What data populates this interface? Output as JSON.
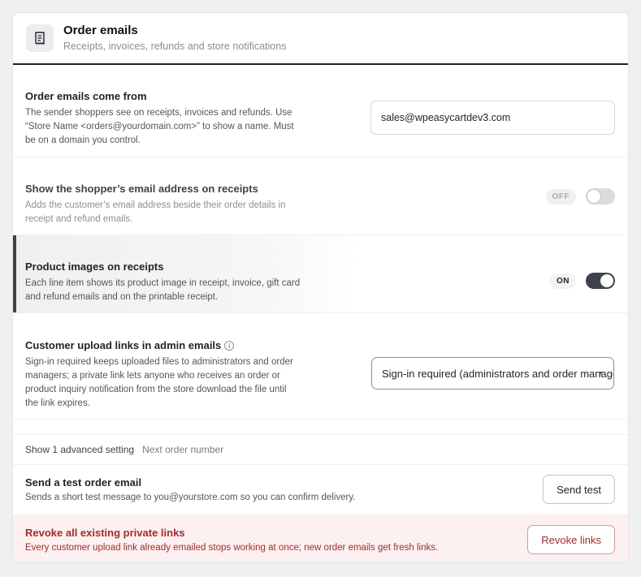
{
  "header": {
    "icon": "receipt-icon",
    "title": "Order emails",
    "subtitle": "Receipts, invoices, refunds and store notifications"
  },
  "from_setting": {
    "title": "Order emails come from",
    "description": "The sender shoppers see on receipts, invoices and refunds. Use “Store Name <orders@yourdomain.com>” to show a name. Must be on a domain you control.",
    "value": "sales@wpeasycartdev3.com"
  },
  "show_email_setting": {
    "title": "Show the shopper’s email address on receipts",
    "description": "Adds the customer’s email address beside their order details in receipt and refund emails.",
    "state_label": "OFF",
    "enabled": false
  },
  "product_images_setting": {
    "title": "Product images on receipts",
    "description": "Each line item shows its product image in receipt, invoice, gift card and refund emails and on the printable receipt.",
    "state_label": "ON",
    "enabled": true
  },
  "upload_links_setting": {
    "title": "Customer upload links in admin emails",
    "info_glyph": "i",
    "description": "Sign-in required keeps uploaded files to administrators and order managers; a private link lets anyone who receives an order or product inquiry notification from the store download the file until the link expires.",
    "selected": "Sign-in required (administrators and order managers)"
  },
  "advanced": {
    "toggle_label": "Show 1 advanced setting",
    "hint": "Next order number"
  },
  "test_email": {
    "title": "Send a test order email",
    "description": "Sends a short test message to you@yourstore.com so you can confirm delivery.",
    "button_label": "Send test"
  },
  "revoke": {
    "title": "Revoke all existing private links",
    "description": "Every customer upload link already emailed stops working at once; new order emails get fresh links.",
    "button_label": "Revoke links"
  },
  "colors": {
    "accent": "#3c434a",
    "danger": "#a12c2c",
    "danger_bg": "#fcf0f1"
  }
}
